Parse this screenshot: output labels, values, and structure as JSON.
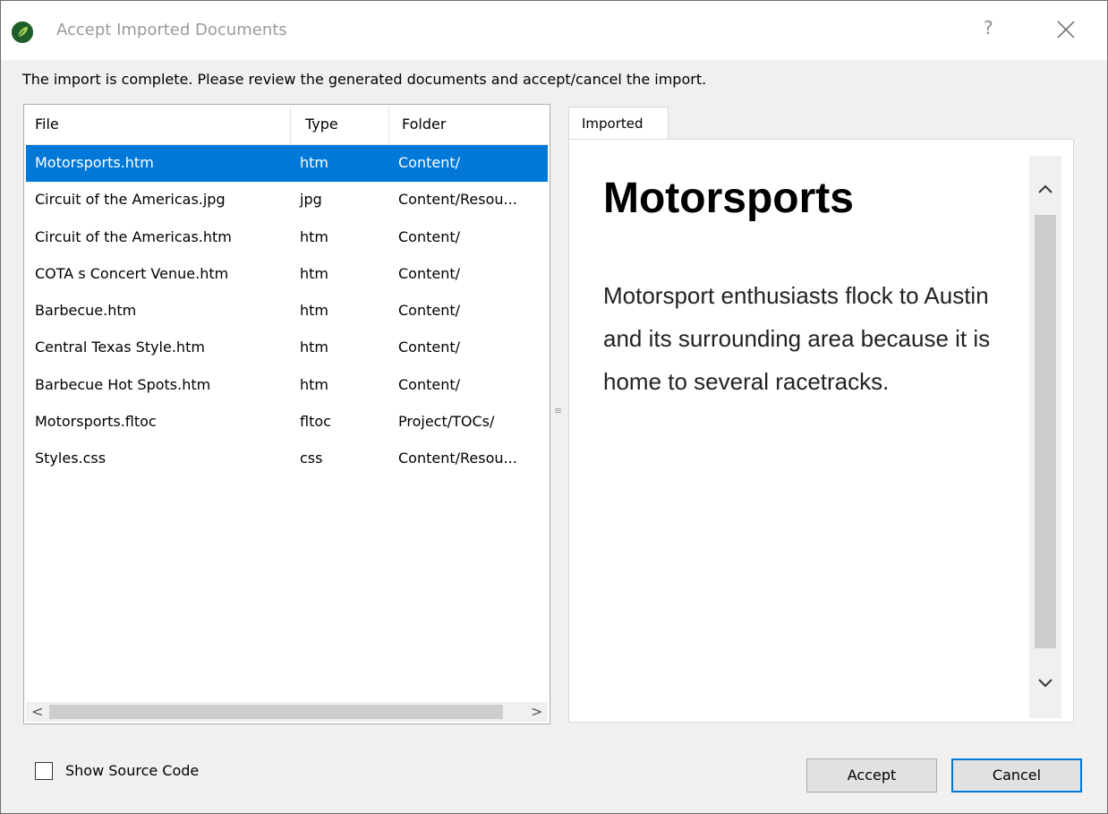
{
  "window": {
    "title": "Accept Imported Documents",
    "help_glyph": "?",
    "icons": {
      "app": "app-leaf-icon",
      "close": "close-icon"
    }
  },
  "instruction": "The import is complete. Please review the generated documents and accept/cancel the import.",
  "file_list": {
    "columns": [
      "File",
      "Type",
      "Folder"
    ],
    "rows": [
      {
        "file": "Motorsports.htm",
        "type": "htm",
        "folder": "Content/"
      },
      {
        "file": "Circuit of the Americas.jpg",
        "type": "jpg",
        "folder": "Content/Resou..."
      },
      {
        "file": "Circuit of the Americas.htm",
        "type": "htm",
        "folder": "Content/"
      },
      {
        "file": "COTA s Concert Venue.htm",
        "type": "htm",
        "folder": "Content/"
      },
      {
        "file": "Barbecue.htm",
        "type": "htm",
        "folder": "Content/"
      },
      {
        "file": "Central Texas Style.htm",
        "type": "htm",
        "folder": "Content/"
      },
      {
        "file": "Barbecue Hot Spots.htm",
        "type": "htm",
        "folder": "Content/"
      },
      {
        "file": "Motorsports.fltoc",
        "type": "fltoc",
        "folder": "Project/TOCs/"
      },
      {
        "file": "Styles.css",
        "type": "css",
        "folder": "Content/Resou..."
      }
    ],
    "selected_index": 0,
    "scroll_left_glyph": "<",
    "scroll_right_glyph": ">"
  },
  "preview": {
    "tab_label": "Imported",
    "heading": "Motorsports",
    "paragraph": "Motorsport enthusiasts flock to Austin and its surrounding area because it is home to several racetracks."
  },
  "footer": {
    "show_source_label": "Show Source Code",
    "show_source_checked": false,
    "accept_label": "Accept",
    "cancel_label": "Cancel"
  },
  "colors": {
    "selection": "#0078d7",
    "dialog_bg": "#f0f0f0",
    "title_text": "#9a9a9a",
    "default_button_border": "#0078d7"
  }
}
